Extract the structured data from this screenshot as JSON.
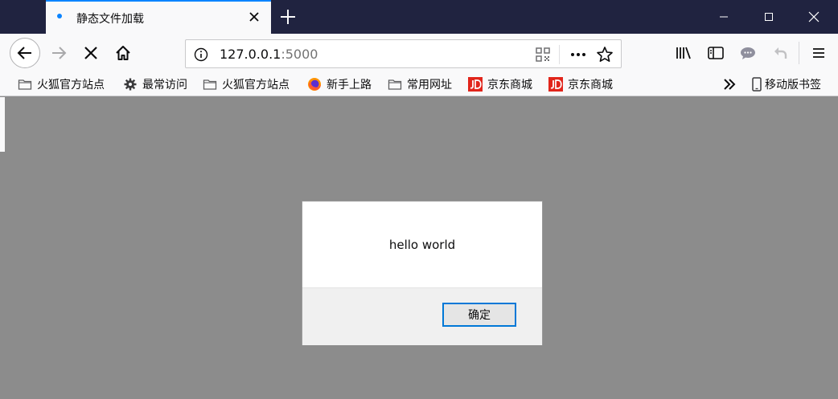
{
  "tab": {
    "title": "静态文件加载"
  },
  "urlbar": {
    "host": "127.0.0.1",
    "port": ":5000"
  },
  "bookmarks": [
    {
      "label": "火狐官方站点",
      "icon": "folder-icon"
    },
    {
      "label": "最常访问",
      "icon": "gear-icon"
    },
    {
      "label": "火狐官方站点",
      "icon": "folder-icon"
    },
    {
      "label": "新手上路",
      "icon": "firefox-icon"
    },
    {
      "label": "常用网址",
      "icon": "folder-icon"
    },
    {
      "label": "京东商城",
      "icon": "jd-icon"
    },
    {
      "label": "京东商城",
      "icon": "jd-icon"
    }
  ],
  "mobile_bookmarks": {
    "label": "移动版书签",
    "icon": "mobile-icon"
  },
  "dialog": {
    "message": "hello world",
    "ok_label": "确定"
  },
  "colors": {
    "titlebar": "#202340",
    "accent": "#0a84ff",
    "page_overlay": "#8c8c8c",
    "jd_red": "#e1251b"
  }
}
